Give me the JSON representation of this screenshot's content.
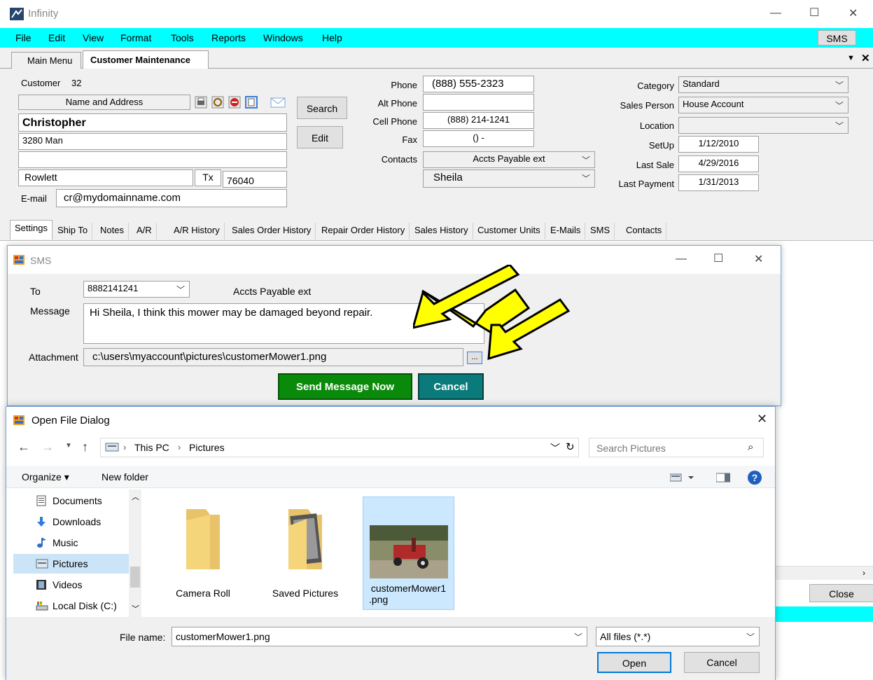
{
  "app": {
    "title": "Infinity"
  },
  "menu": {
    "items": [
      "File",
      "Edit",
      "View",
      "Format",
      "Tools",
      "Reports",
      "Windows",
      "Help"
    ],
    "sms_button": "SMS"
  },
  "tabs": {
    "main_menu": "Main Menu",
    "customer_maintenance": "Customer Maintenance"
  },
  "customer": {
    "label": "Customer",
    "number": "32",
    "name_address_header": "Name and Address",
    "name": "Christopher",
    "address1": "3280 Man",
    "address2": "",
    "city": "Rowlett",
    "state": "Tx",
    "zip": "76040",
    "email_label": "E-mail",
    "email": "cr@mydomainname.com",
    "search_button": "Search",
    "edit_button": "Edit"
  },
  "phones": {
    "phone_label": "Phone",
    "phone": "(888) 555-2323",
    "alt_label": "Alt Phone",
    "alt": "",
    "cell_label": "Cell Phone",
    "cell": "(888) 214-1241",
    "fax_label": "Fax",
    "fax": "() -",
    "contacts_label": "Contacts",
    "contact_type": "Accts Payable ext",
    "contact_name": "Sheila"
  },
  "info": {
    "category_label": "Category",
    "category": "Standard",
    "sales_label": "Sales Person",
    "sales": "House Account",
    "location_label": "Location",
    "location": "",
    "setup_label": "SetUp",
    "setup": "1/12/2010",
    "lastsale_label": "Last Sale",
    "lastsale": "4/29/2016",
    "lastpay_label": "Last Payment",
    "lastpay": "1/31/2013"
  },
  "subtabs": [
    "Settings",
    "Ship To",
    "Notes",
    "A/R",
    "A/R History",
    "Sales Order History",
    "Repair Order History",
    "Sales History",
    "Customer Units",
    "E-Mails",
    "SMS",
    "Contacts"
  ],
  "sms": {
    "title": "SMS",
    "to_label": "To",
    "to": "8882141241",
    "to_contact": "Accts Payable ext",
    "message_label": "Message",
    "message": "Hi Sheila, I think this mower may be damaged beyond repair.",
    "attachment_label": "Attachment",
    "attachment": "c:\\users\\myaccount\\pictures\\customerMower1.png",
    "browse": "...",
    "send": "Send Message Now",
    "cancel": "Cancel"
  },
  "dialog": {
    "title": "Open File Dialog",
    "breadcrumb": [
      "This PC",
      "Pictures"
    ],
    "search_placeholder": "Search Pictures",
    "organize": "Organize ▾",
    "new_folder": "New folder",
    "nav": [
      "Documents",
      "Downloads",
      "Music",
      "Pictures",
      "Videos",
      "Local Disk (C:)"
    ],
    "files": [
      {
        "name": "Camera Roll"
      },
      {
        "name": "Saved Pictures"
      },
      {
        "name": "customerMower1.png",
        "line1": "customerMower1",
        "line2": ".png"
      }
    ],
    "filename_label": "File name:",
    "filename": "customerMower1.png",
    "filter": "All files (*.*)",
    "open": "Open",
    "cancel": "Cancel"
  },
  "main": {
    "close_button": "Close"
  },
  "colors": {
    "menubar": "#00ffff",
    "send": "#0a8a0a",
    "cancel": "#0a7a7a",
    "arrow": "#ffff00",
    "selected": "#cce4f7"
  }
}
